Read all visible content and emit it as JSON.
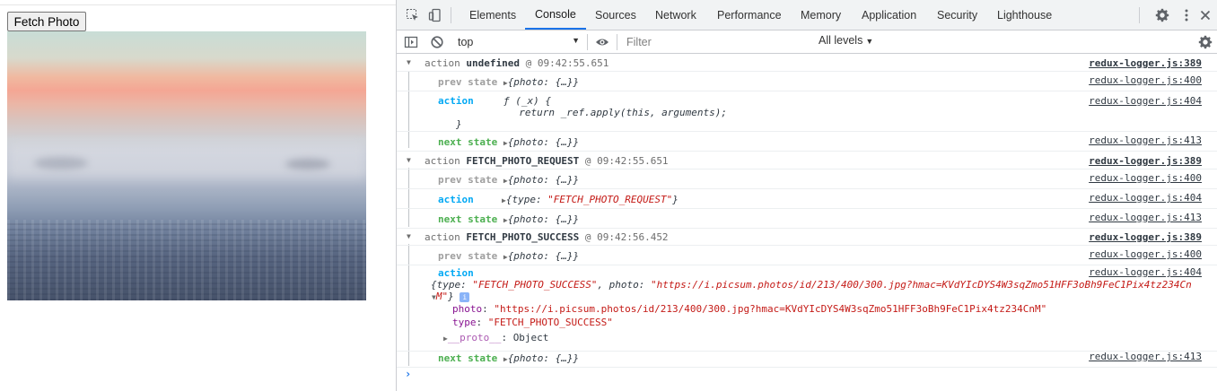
{
  "app": {
    "fetch_button": "Fetch Photo"
  },
  "devtools": {
    "tabs": [
      "Elements",
      "Console",
      "Sources",
      "Network",
      "Performance",
      "Memory",
      "Application",
      "Security",
      "Lighthouse"
    ],
    "active_tab": "Console",
    "context": "top",
    "filter_placeholder": "Filter",
    "levels": "All levels",
    "prompt": "›"
  },
  "console": {
    "groups": [
      {
        "header": {
          "word": "action",
          "type": "undefined",
          "time": "@ 09:42:55.651",
          "source": "redux-logger.js:389"
        },
        "prev": {
          "key": "prev state",
          "value": "{photo: {…}}",
          "source": "redux-logger.js:400"
        },
        "action": {
          "key": "action",
          "line1": "ƒ (_x) {",
          "line2": "  return _ref.apply(this, arguments);",
          "line3": "}",
          "source": "redux-logger.js:404"
        },
        "next": {
          "key": "next state",
          "value": "{photo: {…}}",
          "source": "redux-logger.js:413"
        }
      },
      {
        "header": {
          "word": "action",
          "type": "FETCH_PHOTO_REQUEST",
          "time": "@ 09:42:55.651",
          "source": "redux-logger.js:389"
        },
        "prev": {
          "key": "prev state",
          "value": "{photo: {…}}",
          "source": "redux-logger.js:400"
        },
        "action": {
          "key": "action",
          "pre": "{type: ",
          "str": "\"FETCH_PHOTO_REQUEST\"",
          "post": "}",
          "source": "redux-logger.js:404"
        },
        "next": {
          "key": "next state",
          "value": "{photo: {…}}",
          "source": "redux-logger.js:413"
        }
      },
      {
        "header": {
          "word": "action",
          "type": "FETCH_PHOTO_SUCCESS",
          "time": "@ 09:42:56.452",
          "source": "redux-logger.js:389"
        },
        "prev": {
          "key": "prev state",
          "value": "{photo: {…}}",
          "source": "redux-logger.js:400"
        },
        "action": {
          "key": "action",
          "source": "redux-logger.js:404",
          "summary_pre": "{type: ",
          "summary_type": "\"FETCH_PHOTO_SUCCESS\"",
          "summary_mid": ", photo: ",
          "summary_photo": "\"https://i.picsum.photos/id/213/400/300.jpg?hmac=KVdYIcDYS4W3sqZmo51HFF3oBh9FeC1Pix4tz234Cn",
          "summary_wrap": "M\"",
          "summary_end": "}",
          "info": "i",
          "photo_key": "photo",
          "photo_val": "\"https://i.picsum.photos/id/213/400/300.jpg?hmac=KVdYIcDYS4W3sqZmo51HFF3oBh9FeC1Pix4tz234CnM\"",
          "type_key": "type",
          "type_val": "\"FETCH_PHOTO_SUCCESS\"",
          "proto_key": "__proto__",
          "proto_val": "Object"
        },
        "next": {
          "key": "next state",
          "value": "{photo: {…}}",
          "source": "redux-logger.js:413"
        }
      }
    ]
  }
}
